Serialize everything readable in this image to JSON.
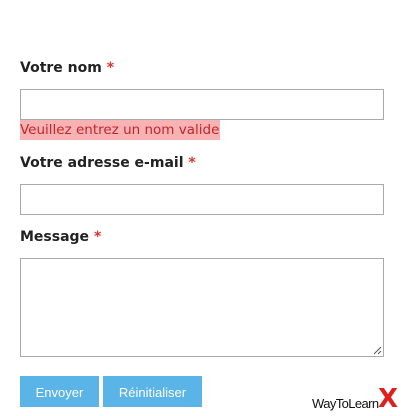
{
  "form": {
    "name_field": {
      "label": "Votre nom",
      "required_mark": "*",
      "value": "",
      "error": "Veuillez entrez un nom valide"
    },
    "email_field": {
      "label": "Votre adresse e-mail",
      "required_mark": "*",
      "value": ""
    },
    "message_field": {
      "label": "Message",
      "required_mark": "*",
      "value": ""
    },
    "buttons": {
      "submit_label": "Envoyer",
      "reset_label": "Réinitialiser"
    }
  },
  "branding": {
    "logo_text": "WayToLearn",
    "logo_mark": "X"
  },
  "colors": {
    "accent_button": "#5ab4e8",
    "required_star": "#e0322b",
    "error_text": "#c8232c",
    "error_background": "#f7b3b3",
    "logo_mark": "#e02020"
  }
}
